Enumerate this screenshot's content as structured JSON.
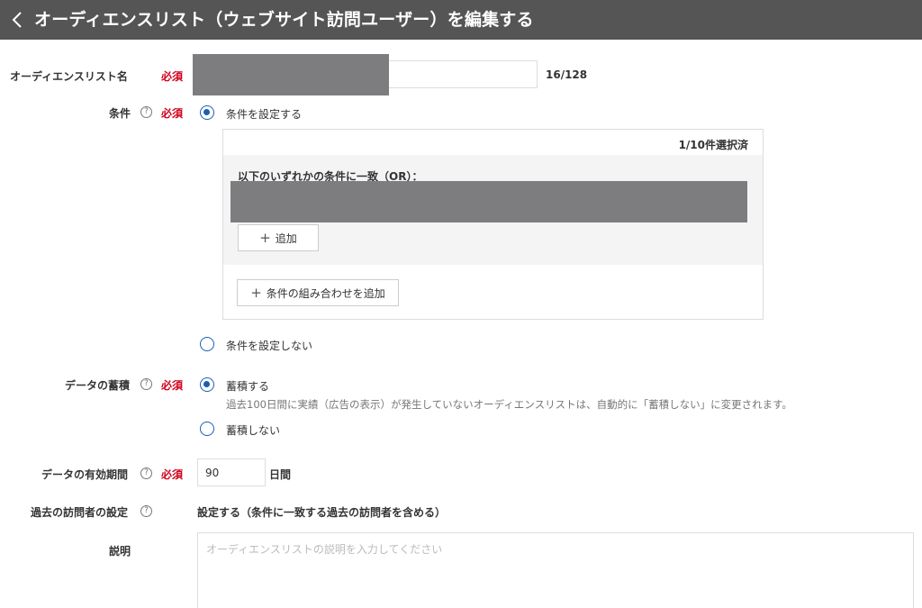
{
  "header": {
    "title": "オーディエンスリスト（ウェブサイト訪問ユーザー）を編集する"
  },
  "required_label": "必須",
  "help_glyph": "?",
  "fields": {
    "name": {
      "label": "オーディエンスリスト名",
      "counter": "16/128"
    },
    "condition": {
      "label": "条件",
      "option_set": "条件を設定する",
      "option_none": "条件を設定しない",
      "selected": "set",
      "selection_count": "1/10件選択済",
      "group_title": "以下のいずれかの条件に一致（OR）：",
      "add_button": "追加",
      "add_combination_button": "条件の組み合わせを追加"
    },
    "accumulate": {
      "label": "データの蓄積",
      "option_on": "蓄積する",
      "option_on_note": "過去100日間に実績（広告の表示）が発生していないオーディエンスリストは、自動的に「蓄積しない」に変更されます。",
      "option_off": "蓄積しない",
      "selected": "on"
    },
    "validity": {
      "label": "データの有効期間",
      "value": "90",
      "unit": "日間"
    },
    "past_visitors": {
      "label": "過去の訪問者の設定",
      "value": "設定する（条件に一致する過去の訪問者を含める）"
    },
    "description": {
      "label": "説明",
      "placeholder": "オーディエンスリストの説明を入力してください"
    }
  },
  "colors": {
    "header_bg": "#555555",
    "required": "#d0021b",
    "radio_accent": "#1a5fb4",
    "redaction": "#7d7d80"
  },
  "icons": {
    "back": "chevron-left-icon",
    "help": "question-circle-icon",
    "add": "plus-icon"
  }
}
